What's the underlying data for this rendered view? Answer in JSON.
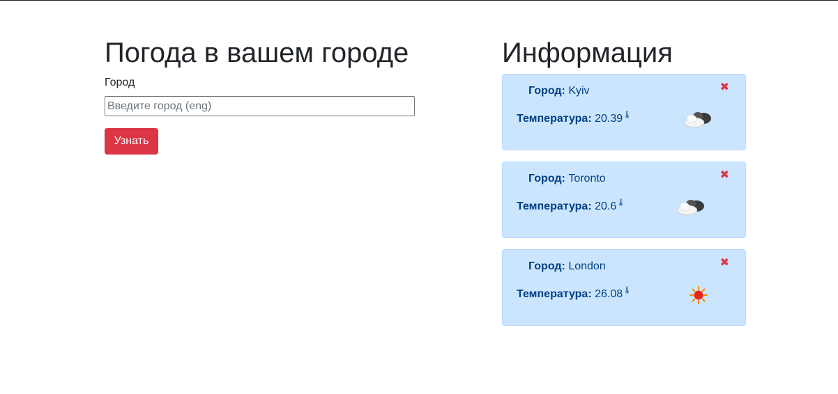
{
  "form": {
    "title": "Погода в вашем городе",
    "city_label": "Город",
    "city_placeholder": "Введите город (eng)",
    "city_value": "",
    "submit_label": "Узнать"
  },
  "info": {
    "title": "Информация",
    "city_prefix": "Город:",
    "temp_prefix": "Температура:",
    "close_icon_glyph": "✖",
    "thermometer_glyph": "🌡",
    "cards": [
      {
        "city": "Kyiv",
        "temperature": "20.39",
        "icon": "cloudy-icon"
      },
      {
        "city": "Toronto",
        "temperature": "20.6",
        "icon": "cloudy-icon"
      },
      {
        "city": "London",
        "temperature": "26.08",
        "icon": "sunny-icon"
      }
    ]
  },
  "colors": {
    "button": "#dc3545",
    "card_bg": "#cce5ff",
    "card_text": "#004085",
    "close": "#dc3545"
  }
}
